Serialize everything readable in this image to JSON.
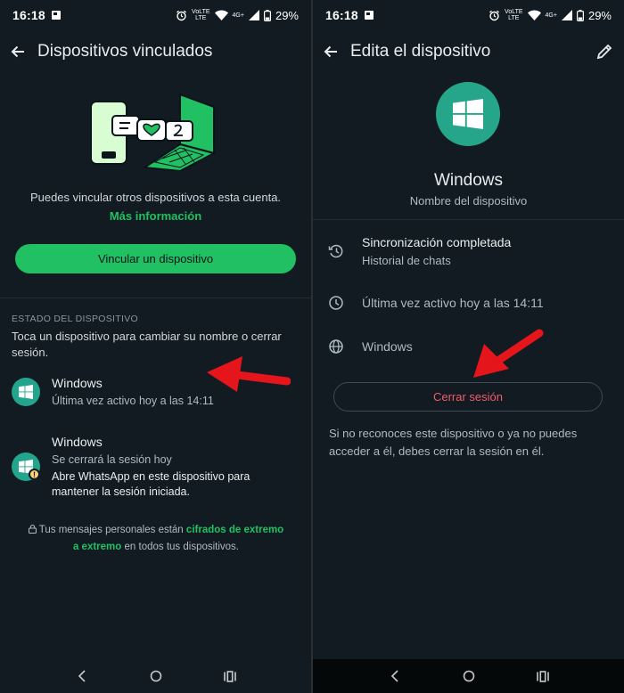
{
  "status_bar": {
    "time": "16:18",
    "battery": "29%",
    "network": "4G+",
    "volte_top": "VoLTE",
    "volte_bottom": "LTE"
  },
  "left": {
    "title": "Dispositivos vinculados",
    "intro": "Puedes vincular otros dispositivos a esta cuenta.",
    "more_info": "Más información",
    "link_button": "Vincular un dispositivo",
    "section_title": "ESTADO DEL DISPOSITIVO",
    "hint": "Toca un dispositivo para cambiar su nombre o cerrar sesión.",
    "devices": [
      {
        "name": "Windows",
        "subtitle": "Última vez activo hoy a las 14:11"
      },
      {
        "name": "Windows",
        "subtitle": "Se cerrará la sesión hoy",
        "warning": "Abre WhatsApp en este dispositivo para mantener la sesión iniciada."
      }
    ],
    "encryption": {
      "before": "Tus mensajes personales están",
      "highlight": "cifrados de extremo a extremo",
      "after": "en todos tus dispositivos."
    }
  },
  "right": {
    "title": "Edita el dispositivo",
    "device_name": "Windows",
    "device_caption": "Nombre del dispositivo",
    "rows": {
      "sync_title": "Sincronización completada",
      "sync_subtitle": "Historial de chats",
      "last_active": "Última vez activo hoy a las 14:11",
      "platform": "Windows"
    },
    "logout_button": "Cerrar sesión",
    "note": "Si no reconoces este dispositivo o ya no puedes acceder a él, debes cerrar la sesión en él."
  },
  "colors": {
    "background": "#111b21",
    "accent_green": "#21c063",
    "teal_avatar": "#22a58c",
    "danger_red": "#f15c6d",
    "annotation_red": "#e4151b",
    "warning_yellow": "#ffd279"
  },
  "icons": [
    "back-arrow-icon",
    "pencil-icon",
    "windows-logo-icon",
    "history-icon",
    "clock-icon",
    "globe-icon",
    "lock-icon",
    "warning-icon",
    "alarm-icon",
    "wifi-icon",
    "signal-icon",
    "battery-icon",
    "nav-back-icon",
    "nav-home-icon",
    "nav-recents-icon"
  ]
}
